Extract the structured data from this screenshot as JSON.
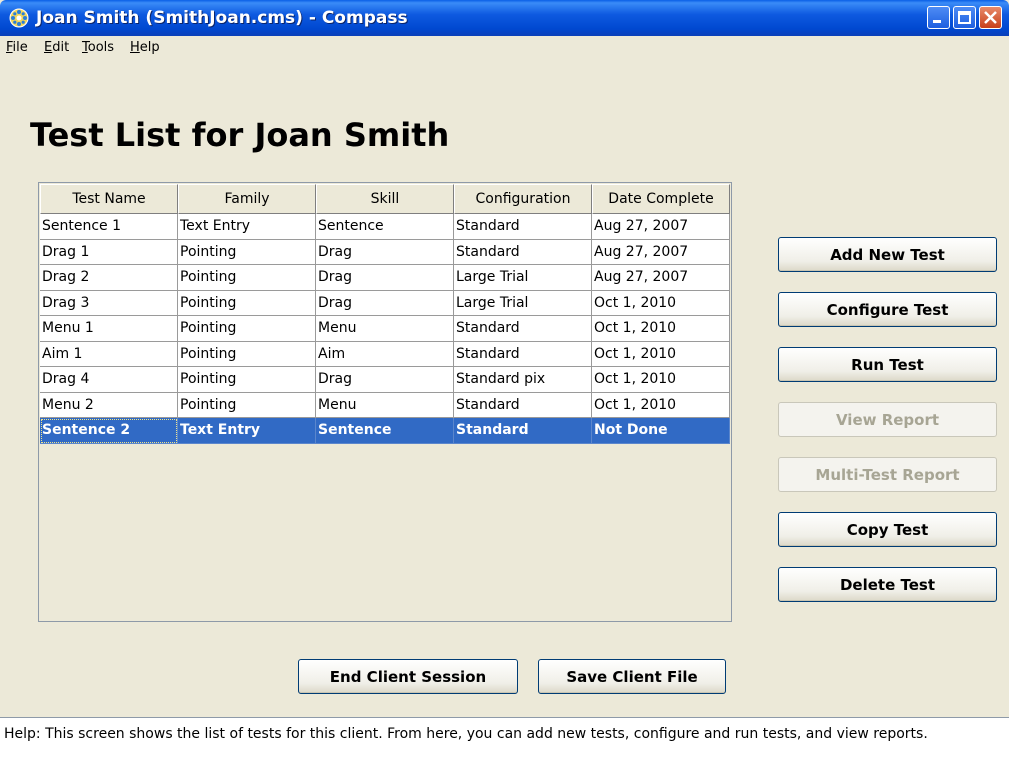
{
  "window": {
    "title": "Joan Smith (SmithJoan.cms) - Compass"
  },
  "menu": [
    "File",
    "Edit",
    "Tools",
    "Help"
  ],
  "heading": "Test List for Joan Smith",
  "table": {
    "columns": [
      "Test Name",
      "Family",
      "Skill",
      "Configuration",
      "Date Complete"
    ],
    "rows": [
      [
        "Sentence 1",
        "Text Entry",
        "Sentence",
        "Standard",
        "Aug 27, 2007"
      ],
      [
        "Drag 1",
        "Pointing",
        "Drag",
        "Standard",
        "Aug 27, 2007"
      ],
      [
        "Drag 2",
        "Pointing",
        "Drag",
        "Large Trial",
        "Aug 27, 2007"
      ],
      [
        "Drag 3",
        "Pointing",
        "Drag",
        "Large Trial",
        "Oct 1, 2010"
      ],
      [
        "Menu 1",
        "Pointing",
        "Menu",
        "Standard",
        "Oct 1, 2010"
      ],
      [
        "Aim 1",
        "Pointing",
        "Aim",
        "Standard",
        "Oct 1, 2010"
      ],
      [
        "Drag 4",
        "Pointing",
        "Drag",
        "Standard pix",
        "Oct 1, 2010"
      ],
      [
        "Menu 2",
        "Pointing",
        "Menu",
        "Standard",
        "Oct 1, 2010"
      ],
      [
        "Sentence 2",
        "Text Entry",
        "Sentence",
        "Standard",
        "Not Done"
      ]
    ],
    "selected_row": 8
  },
  "side_buttons": [
    {
      "label": "Add New Test",
      "enabled": true
    },
    {
      "label": "Configure Test",
      "enabled": true
    },
    {
      "label": "Run Test",
      "enabled": true
    },
    {
      "label": "View Report",
      "enabled": false
    },
    {
      "label": "Multi-Test Report",
      "enabled": false
    },
    {
      "label": "Copy Test",
      "enabled": true
    },
    {
      "label": "Delete Test",
      "enabled": true
    }
  ],
  "bottom_buttons": {
    "end_session": "End Client Session",
    "save_file": "Save Client File"
  },
  "help": "Help: This screen shows the list of tests for this client.  From here, you can add new tests, configure and run tests, and view reports.",
  "colors": {
    "titlebar": "#0a5fe6",
    "selection": "#316ac5",
    "window_bg": "#ece9d8"
  }
}
